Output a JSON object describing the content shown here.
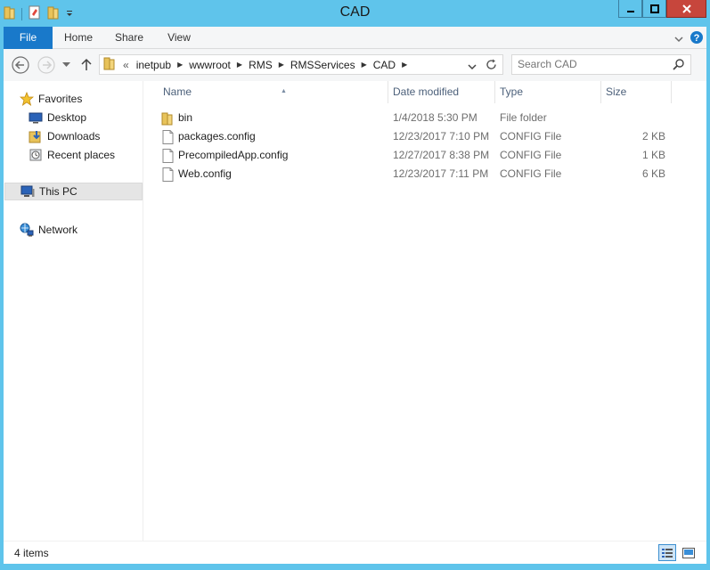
{
  "window": {
    "title": "CAD"
  },
  "ribbon": {
    "tabs": [
      {
        "label": "File"
      },
      {
        "label": "Home"
      },
      {
        "label": "Share"
      },
      {
        "label": "View"
      }
    ]
  },
  "address": {
    "overflow": "«",
    "breadcrumbs": [
      "inetpub",
      "wwwroot",
      "RMS",
      "RMSServices",
      "CAD"
    ]
  },
  "search": {
    "placeholder": "Search CAD"
  },
  "sidebar": {
    "favorites": "Favorites",
    "items": [
      {
        "label": "Desktop",
        "icon": "desktop-icon"
      },
      {
        "label": "Downloads",
        "icon": "downloads-icon"
      },
      {
        "label": "Recent places",
        "icon": "recent-places-icon"
      }
    ],
    "this_pc": "This PC",
    "network": "Network"
  },
  "columns": {
    "name": "Name",
    "date": "Date modified",
    "type": "Type",
    "size": "Size"
  },
  "files": [
    {
      "name": "bin",
      "date": "1/4/2018 5:30 PM",
      "type": "File folder",
      "size": "",
      "icon": "folder-icon"
    },
    {
      "name": "packages.config",
      "date": "12/23/2017 7:10 PM",
      "type": "CONFIG File",
      "size": "2 KB",
      "icon": "file-icon"
    },
    {
      "name": "PrecompiledApp.config",
      "date": "12/27/2017 8:38 PM",
      "type": "CONFIG File",
      "size": "1 KB",
      "icon": "file-icon"
    },
    {
      "name": "Web.config",
      "date": "12/23/2017 7:11 PM",
      "type": "CONFIG File",
      "size": "6 KB",
      "icon": "file-icon"
    }
  ],
  "status": {
    "item_count": "4 items"
  },
  "colors": {
    "accent": "#1979ca",
    "titlebar": "#5fc4eb",
    "close": "#c7463c",
    "folder": "#e8c35a"
  }
}
